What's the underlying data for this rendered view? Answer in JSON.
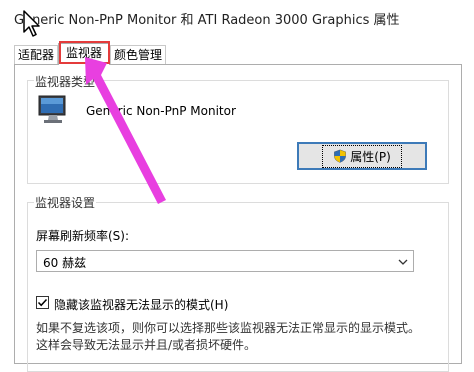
{
  "window": {
    "title": "Generic Non-PnP Monitor 和 ATI Radeon 3000 Graphics 属性"
  },
  "tabs": [
    {
      "label": "适配器"
    },
    {
      "label": "监视器"
    },
    {
      "label": "颜色管理"
    }
  ],
  "monitor_type": {
    "group_title": "监视器类型",
    "icon": "monitor-icon",
    "name": "Generic Non-PnP Monitor",
    "properties_button": "属性(P)",
    "properties_icon": "shield-icon"
  },
  "monitor_settings": {
    "group_title": "监视器设置",
    "refresh_label": "屏幕刷新频率(S):",
    "refresh_value": "60 赫兹",
    "hide_modes_checked": true,
    "hide_modes_label": "隐藏该监视器无法显示的模式(H)",
    "desc_line1": "如果不复选该项，则你可以选择那些该监视器无法正常显示的显示模式。",
    "desc_line2": "这样会导致无法显示并且/或者损坏硬件。"
  },
  "colors": {
    "highlight": "#e43b3b",
    "arrow": "#e83fe0",
    "button_border": "#3d7ab8"
  }
}
